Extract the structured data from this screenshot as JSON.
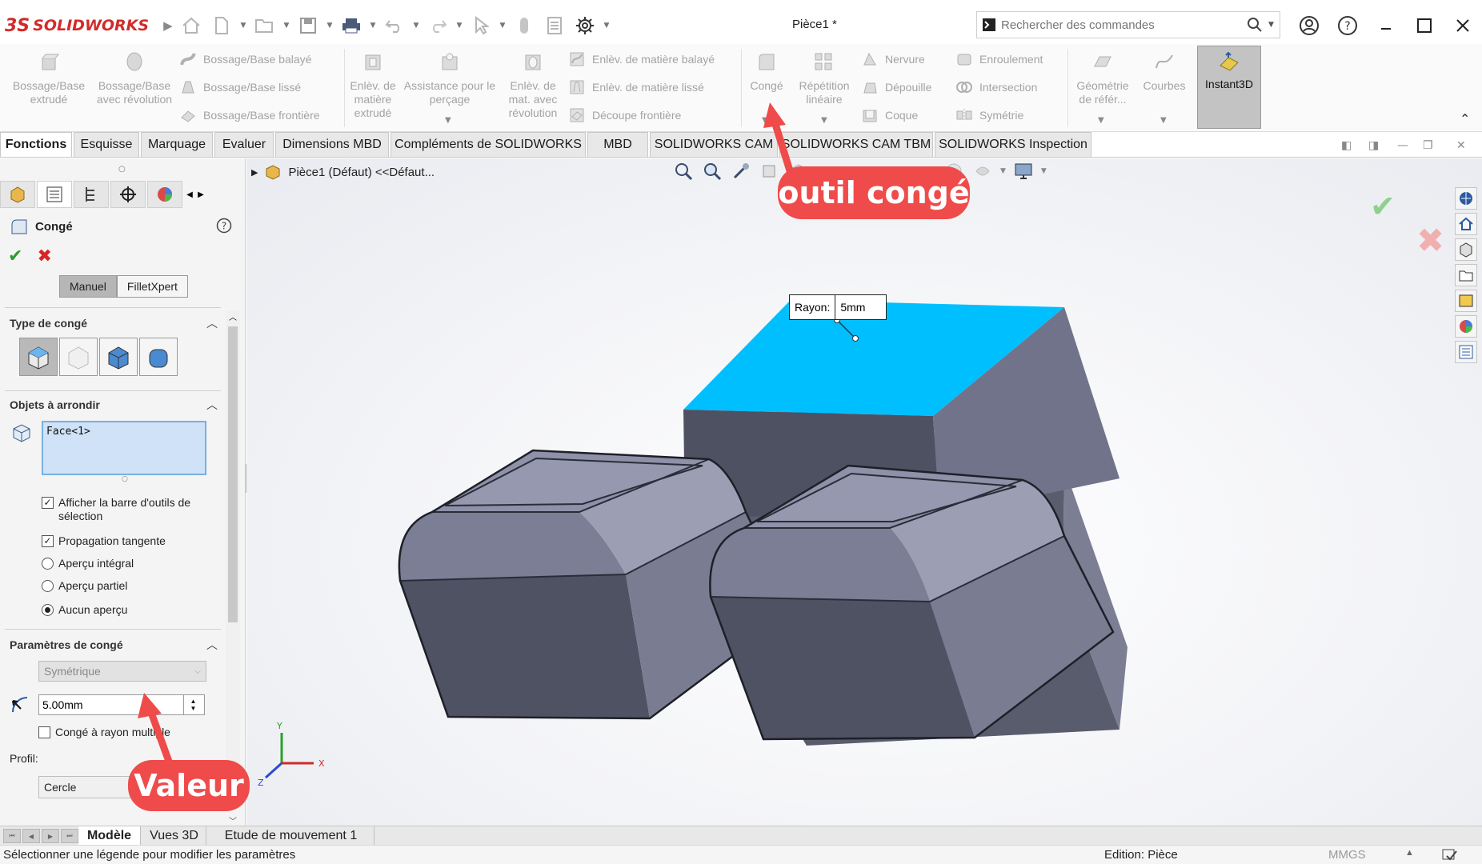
{
  "app": {
    "logo_ds": "3S",
    "logo_name": "SOLIDWORKS",
    "document_title": "Pièce1 *",
    "search_placeholder": "Rechercher des commandes"
  },
  "ribbon": {
    "large_buttons": [
      {
        "id": "bossage-extrude",
        "label": "Bossage/Base extrudé"
      },
      {
        "id": "bossage-revolution",
        "label": "Bossage/Base avec révolution"
      },
      {
        "id": "enlev-extrude",
        "label": "Enlèv. de matière extrudé"
      },
      {
        "id": "assistance-percage",
        "label": "Assistance pour le perçage"
      },
      {
        "id": "enlev-revolution",
        "label": "Enlèv. de mat. avec révolution"
      },
      {
        "id": "conge",
        "label": "Congé"
      },
      {
        "id": "repetition-lineaire",
        "label": "Répétition linéaire"
      },
      {
        "id": "geometrie-reference",
        "label": "Géométrie de référ..."
      },
      {
        "id": "courbes",
        "label": "Courbes"
      },
      {
        "id": "instant3d",
        "label": "Instant3D"
      }
    ],
    "small_buttons": [
      {
        "id": "bossage-balaye",
        "label": "Bossage/Base balayé"
      },
      {
        "id": "bossage-lisse",
        "label": "Bossage/Base lissé"
      },
      {
        "id": "bossage-frontiere",
        "label": "Bossage/Base frontière"
      },
      {
        "id": "enlev-balaye",
        "label": "Enlèv. de matière balayé"
      },
      {
        "id": "enlev-lisse",
        "label": "Enlèv. de matière lissé"
      },
      {
        "id": "decoupe-frontiere",
        "label": "Découpe frontière"
      },
      {
        "id": "nervure",
        "label": "Nervure"
      },
      {
        "id": "depouille",
        "label": "Dépouille"
      },
      {
        "id": "coque",
        "label": "Coque"
      },
      {
        "id": "enroulement",
        "label": "Enroulement"
      },
      {
        "id": "intersection",
        "label": "Intersection"
      },
      {
        "id": "symetrie",
        "label": "Symétrie"
      }
    ]
  },
  "tabs": [
    {
      "label": "Fonctions",
      "active": true
    },
    {
      "label": "Esquisse"
    },
    {
      "label": "Marquage"
    },
    {
      "label": "Evaluer"
    },
    {
      "label": "Dimensions MBD"
    },
    {
      "label": "Compléments de SOLIDWORKS"
    },
    {
      "label": "MBD"
    },
    {
      "label": "SOLIDWORKS CAM"
    },
    {
      "label": "SOLIDWORKS CAM TBM"
    },
    {
      "label": "SOLIDWORKS Inspection"
    }
  ],
  "property_manager": {
    "title": "Congé",
    "mode_manual": "Manuel",
    "mode_expert": "FilletXpert",
    "type_section": "Type de congé",
    "objects_section": "Objets à arrondir",
    "selected_item": "Face<1>",
    "options": [
      {
        "label": "Afficher la barre d'outils de sélection",
        "kind": "checkbox",
        "checked": true
      },
      {
        "label": "Propagation tangente",
        "kind": "checkbox",
        "checked": true
      },
      {
        "label": "Aperçu intégral",
        "kind": "radio",
        "checked": false
      },
      {
        "label": "Aperçu partiel",
        "kind": "radio",
        "checked": false
      },
      {
        "label": "Aucun aperçu",
        "kind": "radio",
        "checked": true
      }
    ],
    "params_section": "Paramètres de congé",
    "method": "Symétrique",
    "radius_value": "5.00mm",
    "multi_radius_label": "Congé à rayon multiple",
    "profile_label": "Profil:",
    "profile_value": "Cercle"
  },
  "viewport": {
    "feature_tree_label": "Pièce1 (Défaut) <<Défaut...",
    "radius_callout_label": "Rayon:",
    "radius_callout_value": "5mm",
    "axis_x": "X",
    "axis_y": "Y",
    "axis_z": "Z",
    "highlight_color": "#00bfff"
  },
  "annotations": {
    "callout_tool": "outil congé",
    "callout_value": "Valeur",
    "callout_color": "#ef4b4b"
  },
  "bottom_tabs": [
    {
      "label": "Modèle",
      "active": true
    },
    {
      "label": "Vues 3D"
    },
    {
      "label": "Etude de mouvement 1"
    }
  ],
  "status": {
    "message": "Sélectionner une légende pour modifier les paramètres",
    "edit_mode": "Edition: Pièce",
    "units": "MMGS"
  }
}
